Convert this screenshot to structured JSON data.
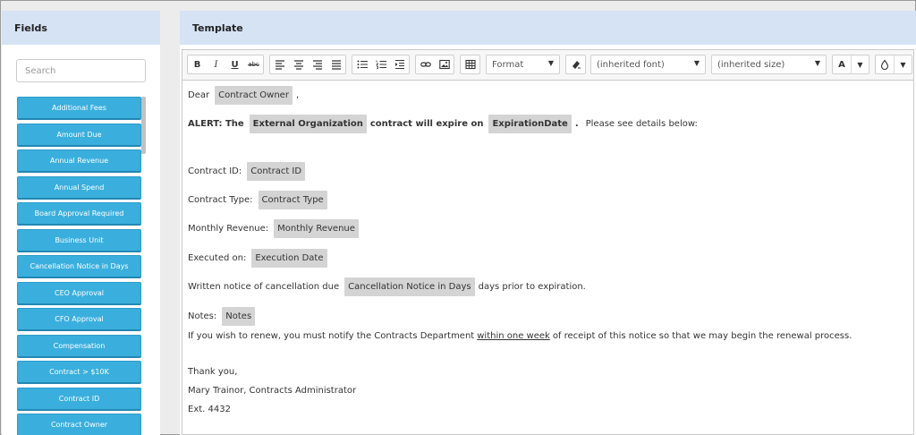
{
  "left_panel": {
    "title": "Fields",
    "search_placeholder": "Search",
    "fields": [
      "Additional Fees",
      "Amount Due",
      "Annual Revenue",
      "Annual Spend",
      "Board Approval Required",
      "Business Unit",
      "Cancellation Notice in Days",
      "CEO Approval",
      "CFO Approval",
      "Compensation",
      "Contract > $10K",
      "Contract ID",
      "Contract Owner"
    ],
    "field_color": "#3aafdd"
  },
  "right_panel": {
    "title": "Template",
    "toolbar": {
      "bold": "B",
      "italic": "I",
      "underline": "U",
      "strike": "abc",
      "format_label": "Format",
      "font_label": "(inherited font)",
      "size_label": "(inherited size)",
      "font_color_label": "A",
      "icons": [
        "align-left-icon",
        "align-center-icon",
        "align-right-icon",
        "align-justify-icon",
        "bulleted-list-icon",
        "numbered-list-icon",
        "indent-icon",
        "link-icon",
        "image-icon",
        "table-icon",
        "clear-format-icon",
        "highlight-icon"
      ]
    },
    "letter": {
      "dear": "Dear",
      "dear_tag": "Contract Owner",
      "dear_comma": ",",
      "alert_prefix": "ALERT:  The",
      "alert_tag1": "External Organization",
      "alert_mid": "contract will expire on",
      "alert_tag2": "ExpirationDate",
      "alert_dot": ".",
      "alert_suffix": "Please see details below:",
      "contract_id_label": "Contract ID:",
      "contract_id_tag": "Contract ID",
      "contract_type_label": "Contract Type:",
      "contract_type_tag": "Contract Type",
      "monthly_revenue_label": "Monthly Revenue:",
      "monthly_revenue_tag": "Monthly Revenue",
      "executed_label": "Executed on:",
      "executed_tag": "Execution Date",
      "notice_prefix": "Written notice of cancellation due",
      "notice_tag": "Cancellation Notice in Days",
      "notice_suffix": "days prior to expiration.",
      "notes_label": "Notes:",
      "notes_tag": "Notes",
      "renew_prefix": "If you wish to renew, you must notify the Contracts Department",
      "renew_underlined": "within one week",
      "renew_suffix": "of receipt of this notice so that we may begin the renewal process.",
      "thanks": "Thank you,",
      "signature": "Mary Trainor, Contracts Administrator",
      "extension": "Ext. 4432"
    }
  }
}
